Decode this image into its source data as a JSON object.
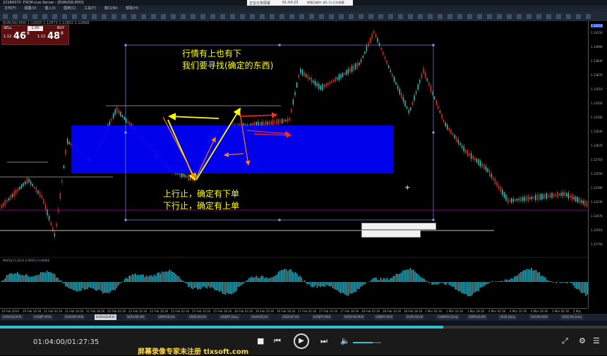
{
  "window": {
    "title": "22184373: FXCM-Live Server - [EURUSD,M30]"
  },
  "recording": {
    "label": "正在分享屏幕",
    "time": "01:04:23",
    "detail": "视频压缩中, 待1.3人正在观看"
  },
  "menu": [
    "文件(F)",
    "视图(V)",
    "插入(I)",
    "图表(C)",
    "工具(T)",
    "窗口(W)",
    "帮助(H)"
  ],
  "symbol_label": "EURUSD,M30  1.12835 1.12873 1.12802 1.12868",
  "trade_panel": {
    "sell_label": "SELL",
    "buy_label": "BUY",
    "lot": "1.00",
    "sell_price": "1.12",
    "sell_big": "46",
    "sell_sup": "8",
    "buy_price": "1.12",
    "buy_big": "48",
    "buy_sup": "8"
  },
  "price_ticks": [
    "1.14150",
    "1.13990",
    "1.13830",
    "1.13670",
    "1.13510",
    "1.13350",
    "1.13190",
    "1.13030",
    "1.12870",
    "1.12710",
    "1.12550",
    "1.12390",
    "1.12230",
    "1.12070",
    "1.11910",
    "1.11750"
  ],
  "current_price": "1.14210",
  "annotations": {
    "top_line1": "行情有上也有下",
    "top_line2": "我们要寻找(确定的东西)",
    "bottom_line1": "上行止，确定有下单",
    "bottom_line2": "下行止，确定有上单"
  },
  "indicator_label": "MACD(12,26,9) 0.00053 0.00066",
  "date_ticks": [
    "20 Feb 2019",
    "20 Feb 16:30",
    "21 Feb 02:30",
    "21 Feb 10:30",
    "21 Feb 18:30",
    "22 Feb 02:30",
    "22 Feb 10:30",
    "22 Feb 18:30",
    "25 Feb 02:30",
    "25 Feb 10:30",
    "25 Feb 18:30",
    "26 Feb 02:30",
    "26 Feb 10:30",
    "26 Feb 18:30",
    "27 Feb 02:30",
    "27 Feb 10:30",
    "27 Feb 18:30",
    "28 Feb 02:30",
    "28 Feb 10:30",
    "28 Feb 18:30",
    "1 Mar 02:30",
    "1 Mar 10:30",
    "1 Mar 18:30",
    "4 Mar 02:30",
    "4 Mar 10:30",
    "4 Mar 18:30",
    "5 Mar 02:30",
    "5 Mar 10:30"
  ],
  "tabs": [
    "EURUSD,M30",
    "AUDJPY,M30",
    "EURGBP,M30",
    "EURUSD,M30",
    "NZDUSD,M5",
    "GBPUSD,H4",
    "USDCAD,H4",
    "USDJPY,Daily",
    "XAUUSD,H1",
    "USDCHF,H4",
    "EURJPY,M30",
    "NZDCAD,M30",
    "GBPJPY,M30",
    "EURCAD,H4",
    "CHINA50,Daily",
    "GBPAUD,M5",
    "US30,Daily",
    "SUGAR,M30",
    "USDCAD,Daily"
  ],
  "active_tab_index": 3,
  "player": {
    "current_time": "01:04:00",
    "total_time": "01:27:35",
    "progress": 0.73,
    "volume": 0.7,
    "watermark": "屏幕录像专家未注册 tlxsoft.com"
  },
  "colors": {
    "rect_blue": "#0000ff",
    "annotation_yellow": "#ffff00",
    "arrow_red": "#ff2a1a",
    "arrow_orange": "#ff7a1a",
    "bull": "#2bd1c2",
    "bear": "#e03020",
    "accent": "#35c0d0"
  }
}
